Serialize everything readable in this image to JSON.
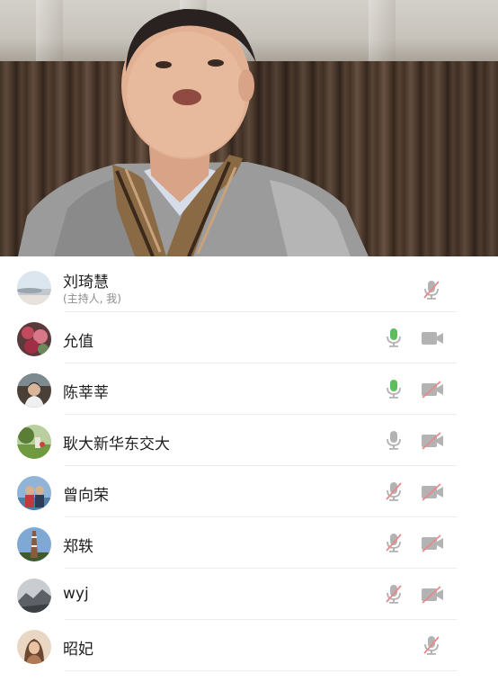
{
  "colors": {
    "mic_active": "#5bbf5c",
    "icon_inactive": "#b3b3b3",
    "muted_slash": "#e8898d",
    "name_text": "#1f1f1f",
    "sub_text": "#8d8d8d"
  },
  "participants": [
    {
      "name": "刘琦慧",
      "sub": "(主持人, 我)",
      "mic": "muted",
      "camera": "none",
      "avatar": "landscape-sky"
    },
    {
      "name": "允值",
      "mic": "active",
      "camera": "on",
      "avatar": "flowers"
    },
    {
      "name": "陈莘莘",
      "mic": "active",
      "camera": "off",
      "avatar": "person-dark"
    },
    {
      "name": "耿大新华东交大",
      "mic": "on",
      "camera": "off",
      "avatar": "green-field"
    },
    {
      "name": "曾向荣",
      "mic": "muted",
      "camera": "off",
      "avatar": "couple-blue"
    },
    {
      "name": "郑轶",
      "mic": "muted",
      "camera": "off",
      "avatar": "tower-sky"
    },
    {
      "name": "wyj",
      "mic": "muted",
      "camera": "off",
      "avatar": "mountain-grey"
    },
    {
      "name": "昭妃",
      "mic": "muted",
      "camera": "none",
      "avatar": "woman-warm"
    }
  ]
}
